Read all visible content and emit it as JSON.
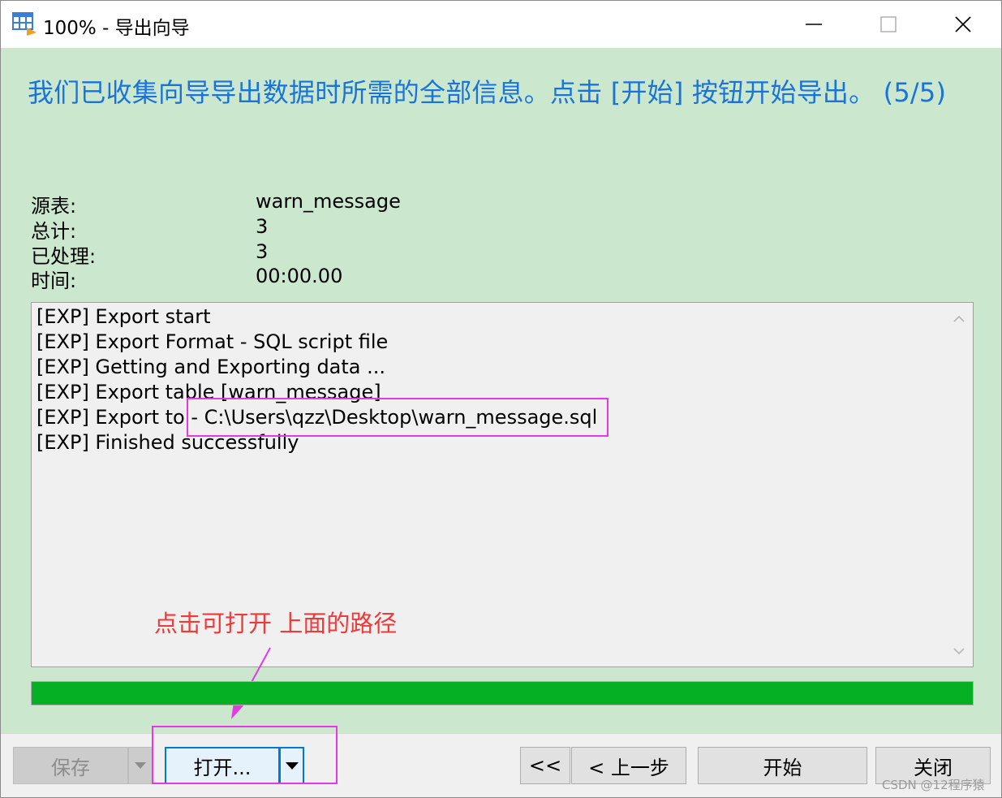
{
  "window": {
    "title": "100% - 导出向导"
  },
  "headline": "我们已收集向导导出数据时所需的全部信息。点击 [开始] 按钮开始导出。 (5/5)",
  "info": [
    {
      "label": "源表:",
      "value": "warn_message"
    },
    {
      "label": "总计:",
      "value": "3"
    },
    {
      "label": "已处理:",
      "value": "3"
    },
    {
      "label": "时间:",
      "value": "00:00.00"
    }
  ],
  "log": [
    "[EXP] Export start",
    "[EXP] Export Format - SQL script file",
    "[EXP] Getting and Exporting data ...",
    "[EXP] Export table [warn_message]",
    "[EXP] Export to - C:\\Users\\qzz\\Desktop\\warn_message.sql",
    "[EXP] Finished successfully"
  ],
  "annotation": "点击可打开 上面的路径",
  "progress": 1.0,
  "footer": {
    "save_label": "保存",
    "open_label": "打开...",
    "first_label": "<<",
    "back_label": "< 上一步",
    "start_label": "开始",
    "close_label": "关闭"
  },
  "watermark": "CSDN @12程序猿",
  "colors": {
    "accent": "#1a73d9",
    "panel_bg": "#cbe8cf",
    "progress": "#06b025",
    "highlight": "#e639e6",
    "annotation": "#f03a3a"
  }
}
